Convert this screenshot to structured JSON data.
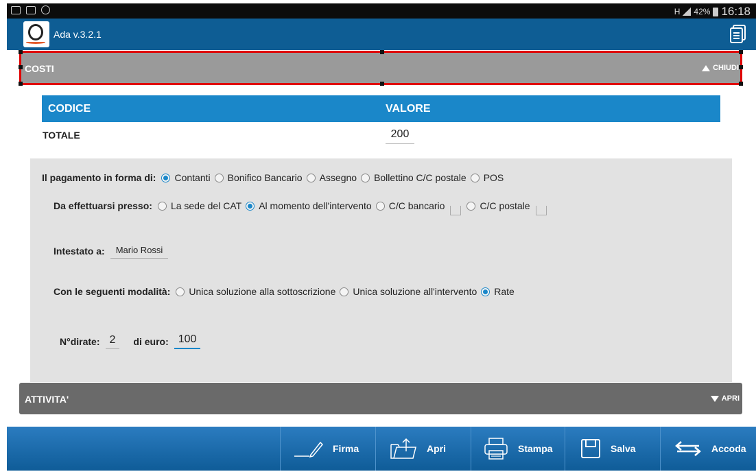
{
  "status_bar": {
    "battery": "42%",
    "time": "16:18",
    "network": "H"
  },
  "app": {
    "title": "Ada v.3.2.1"
  },
  "costi": {
    "label": "COSTI",
    "toggle_label": "CHIUDI"
  },
  "table": {
    "headers": [
      "CODICE",
      "VALORE"
    ],
    "total_label": "TOTALE",
    "total_value": "200"
  },
  "payment": {
    "form_label": "Il pagamento in forma di:",
    "form_options": [
      "Contanti",
      "Bonifico Bancario",
      "Assegno",
      "Bollettino C/C postale",
      "POS"
    ],
    "form_selected": "Contanti",
    "place_label": "Da effettuarsi presso:",
    "place_options": [
      "La sede del CAT",
      "Al momento dell'intervento",
      "C/C bancario",
      "C/C postale"
    ],
    "place_selected": "Al momento dell'intervento",
    "holder_label": "Intestato a:",
    "holder_value": "Mario Rossi",
    "mode_label": "Con le seguenti modalità:",
    "mode_options": [
      "Unica soluzione alla sottoscrizione",
      "Unica soluzione all'intervento",
      "Rate"
    ],
    "mode_selected": "Rate",
    "installments_label": "N°dirate:",
    "installments_value": "2",
    "amount_label": "di euro:",
    "amount_value": "100"
  },
  "attivita": {
    "label": "ATTIVITA'",
    "toggle_label": "APRI"
  },
  "actions": {
    "firma": "Firma",
    "apri": "Apri",
    "stampa": "Stampa",
    "salva": "Salva",
    "accoda": "Accoda"
  },
  "colors": {
    "header": "#0e5d94",
    "accent": "#1a87c9",
    "highlight": "#e00000"
  }
}
